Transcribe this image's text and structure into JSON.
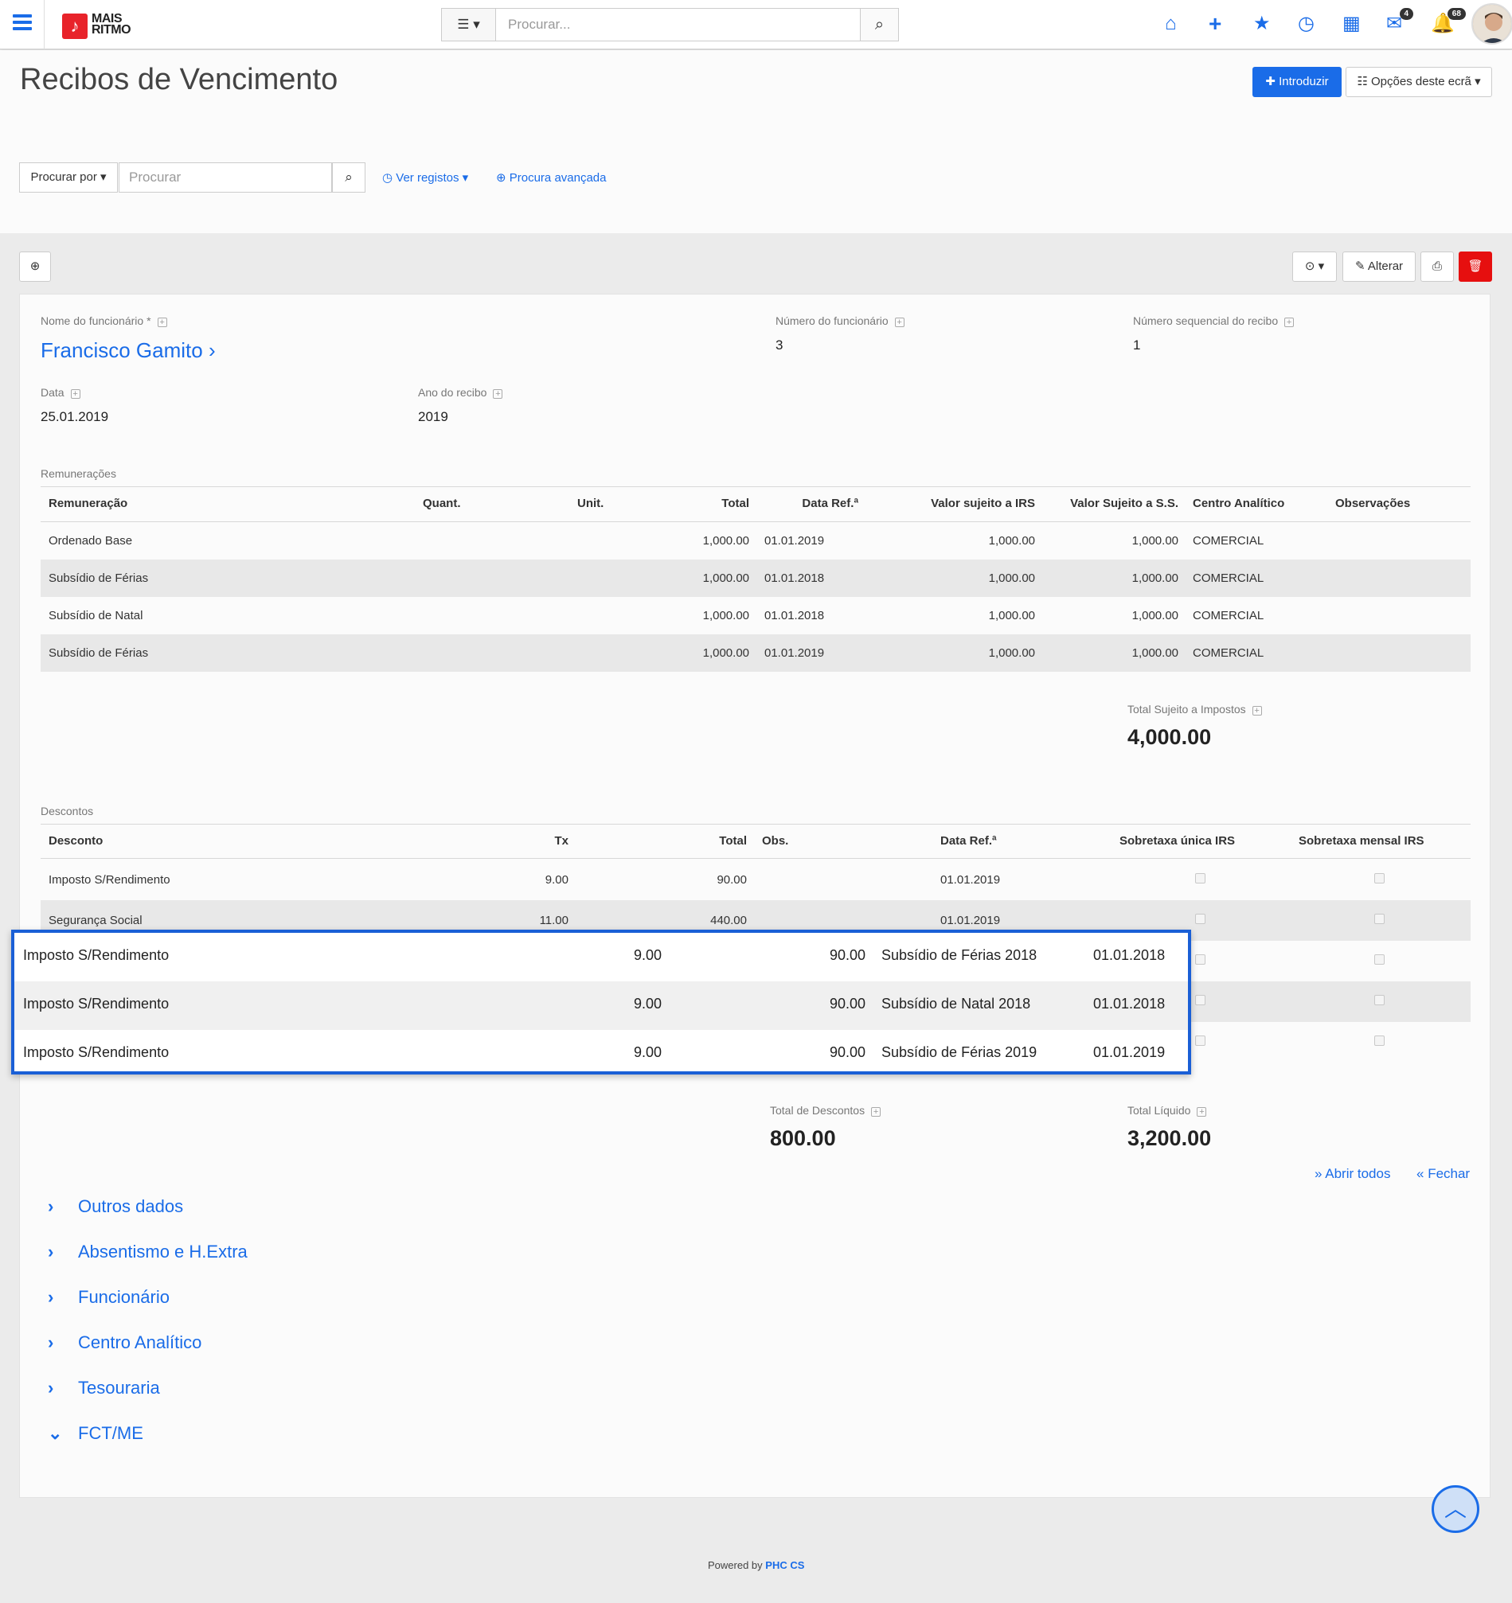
{
  "topbar": {
    "logo_line1": "MAIS",
    "logo_line2": "RITMO",
    "search_placeholder": "Procurar...",
    "mail_badge": "4",
    "notif_badge": "68"
  },
  "page": {
    "title": "Recibos de Vencimento",
    "introduzir": "Introduzir",
    "opcoes": "Opções deste ecrã",
    "procurar_por": "Procurar por",
    "procurar_placeholder": "Procurar",
    "ver_registos": "Ver registos",
    "procura_avancada": "Procura avançada",
    "alterar": "Alterar"
  },
  "fields": {
    "nome_label": "Nome do funcionário *",
    "nome_value": "Francisco Gamito",
    "numero_label": "Número do funcionário",
    "numero_value": "3",
    "seq_label": "Número sequencial do recibo",
    "seq_value": "1",
    "data_label": "Data",
    "data_value": "25.01.2019",
    "ano_label": "Ano do recibo",
    "ano_value": "2019"
  },
  "remuneracoes": {
    "section": "Remunerações",
    "headers": [
      "Remuneração",
      "Quant.",
      "Unit.",
      "Total",
      "Data Ref.ª",
      "Valor sujeito a IRS",
      "Valor Sujeito a S.S.",
      "Centro Analítico",
      "Observações"
    ],
    "rows": [
      [
        "Ordenado Base",
        "",
        "",
        "1,000.00",
        "01.01.2019",
        "1,000.00",
        "1,000.00",
        "COMERCIAL",
        ""
      ],
      [
        "Subsídio de Férias",
        "",
        "",
        "1,000.00",
        "01.01.2018",
        "1,000.00",
        "1,000.00",
        "COMERCIAL",
        ""
      ],
      [
        "Subsídio de Natal",
        "",
        "",
        "1,000.00",
        "01.01.2018",
        "1,000.00",
        "1,000.00",
        "COMERCIAL",
        ""
      ],
      [
        "Subsídio de Férias",
        "",
        "",
        "1,000.00",
        "01.01.2019",
        "1,000.00",
        "1,000.00",
        "COMERCIAL",
        ""
      ]
    ],
    "total_label": "Total Sujeito a Impostos",
    "total_value": "4,000.00"
  },
  "descontos": {
    "section": "Descontos",
    "headers": [
      "Desconto",
      "Tx",
      "Total",
      "Obs.",
      "Data Ref.ª",
      "Sobretaxa única IRS",
      "Sobretaxa mensal IRS"
    ],
    "rows": [
      [
        "Imposto S/Rendimento",
        "9.00",
        "90.00",
        "",
        "01.01.2019"
      ],
      [
        "Segurança Social",
        "11.00",
        "440.00",
        "",
        "01.01.2019"
      ]
    ],
    "overlay_rows": [
      [
        "Imposto S/Rendimento",
        "9.00",
        "90.00",
        "Subsídio de Férias 2018",
        "01.01.2018"
      ],
      [
        "Imposto S/Rendimento",
        "9.00",
        "90.00",
        "Subsídio de Natal 2018",
        "01.01.2018"
      ],
      [
        "Imposto S/Rendimento",
        "9.00",
        "90.00",
        "Subsídio de Férias 2019",
        "01.01.2019"
      ]
    ],
    "total_desc_label": "Total de Descontos",
    "total_desc_value": "800.00",
    "total_liq_label": "Total Líquido",
    "total_liq_value": "3,200.00"
  },
  "accordion": {
    "abrir_todos": "Abrir todos",
    "fechar": "Fechar",
    "items": [
      "Outros dados",
      "Absentismo e H.Extra",
      "Funcionário",
      "Centro Analítico",
      "Tesouraria",
      "FCT/ME"
    ]
  },
  "footer": {
    "powered": "Powered by",
    "brand": "PHC CS"
  },
  "colors": {
    "accent": "#1a6ce8",
    "danger": "#e60f0f",
    "logo": "#e8232a"
  }
}
